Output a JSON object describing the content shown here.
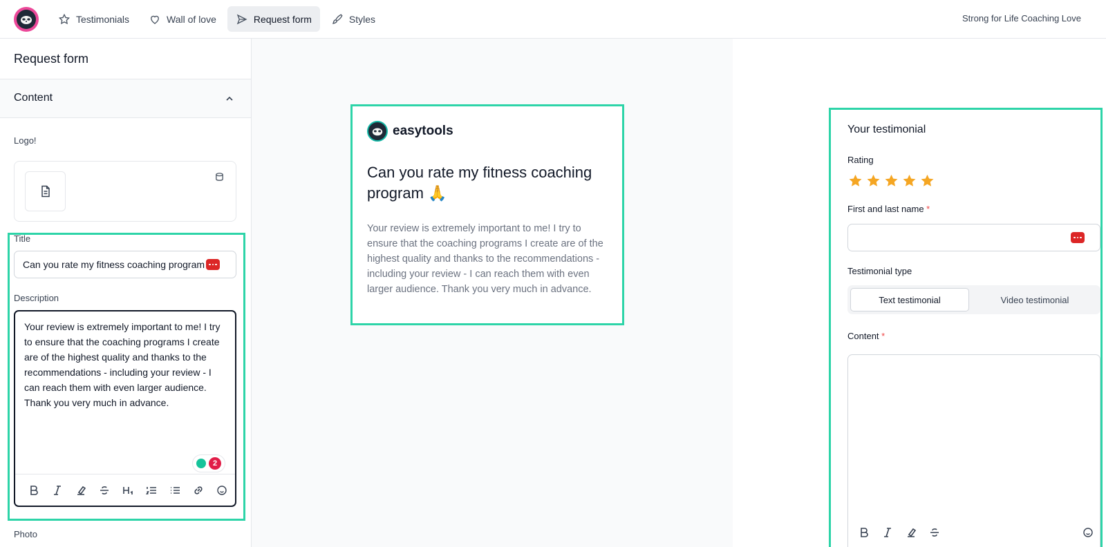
{
  "nav": {
    "items": [
      {
        "label": "Testimonials",
        "icon": "star-icon"
      },
      {
        "label": "Wall of love",
        "icon": "heart-icon"
      },
      {
        "label": "Request form",
        "icon": "send-icon",
        "active": true
      },
      {
        "label": "Styles",
        "icon": "brush-icon"
      }
    ],
    "brand_name": "Strong for Life Coaching Love"
  },
  "sidebar": {
    "title": "Request form",
    "section_label": "Content",
    "logo_label": "Logo!",
    "title_label": "Title",
    "title_value": "Can you rate my fitness coaching program",
    "description_label": "Description",
    "description_value": "Your review is extremely important to me! I try to ensure that the coaching programs I create are of the highest quality and thanks to the recommendations - including your review - I can reach them with even larger audience. Thank you very much in advance.",
    "grammar_count": "2",
    "photo_label": "Photo",
    "toolbar_icons": [
      "bold-icon",
      "italic-icon",
      "highlight-icon",
      "strikethrough-icon",
      "heading-icon",
      "ordered-list-icon",
      "bullet-list-icon",
      "link-icon",
      "emoji-icon"
    ]
  },
  "preview": {
    "brand": "easytools",
    "title": "Can you rate my fitness coaching program",
    "title_emoji": "🙏",
    "description": "Your review is extremely important to me! I try to ensure that the coaching programs I create are of the highest quality and thanks to the recommendations - including your review - I can reach them with even larger audience. Thank you very much in advance."
  },
  "form": {
    "heading": "Your testimonial",
    "rating_label": "Rating",
    "rating_value": 5,
    "rating_max": 5,
    "name_label": "First and last name",
    "required_mark": "*",
    "type_label": "Testimonial type",
    "type_options": [
      "Text testimonial",
      "Video testimonial"
    ],
    "type_selected": "Text testimonial",
    "content_label": "Content"
  },
  "colors": {
    "accent": "#2dd4a8",
    "star": "#f5a623",
    "required": "#ef4444",
    "logo_ring": "#ec4899"
  }
}
